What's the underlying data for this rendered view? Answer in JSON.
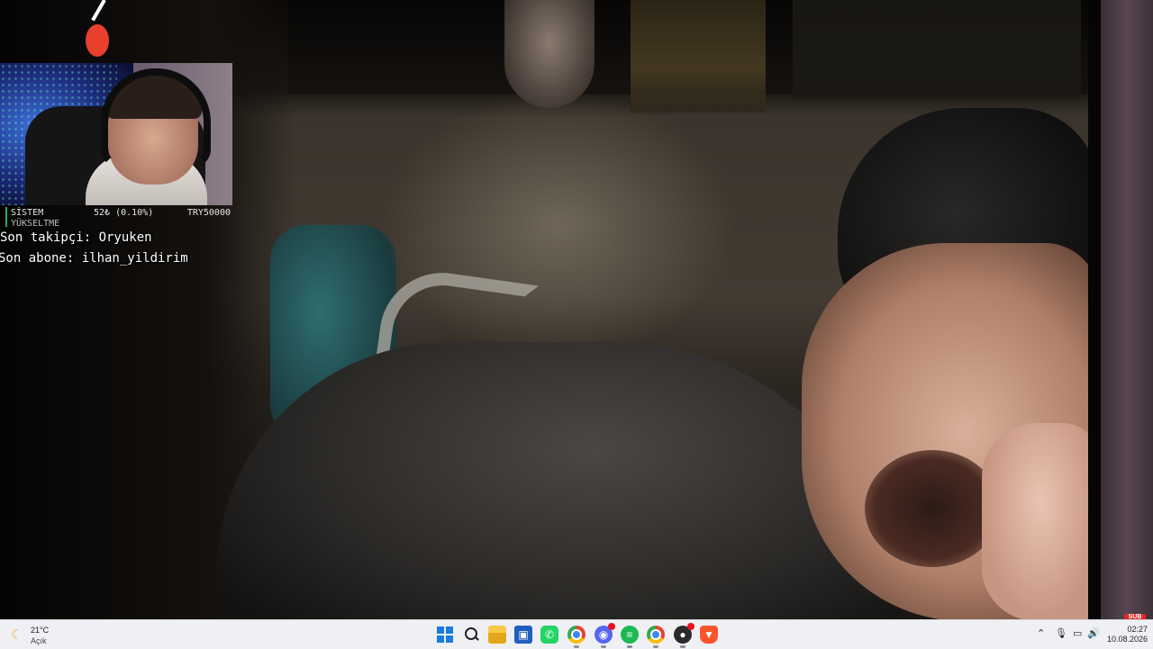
{
  "stream": {
    "stats": {
      "label": "SİSTEM",
      "label2": "YÜKSELTME",
      "value": "52₺ (0.10%)",
      "goal": "TRY50000"
    },
    "last_follower": "Son takipçi: Oryuken",
    "last_subscriber": "Son abone: ilhan_yildirim",
    "sub_badge": "SUB"
  },
  "taskbar": {
    "weather": {
      "temp": "21°C",
      "condition": "Açık",
      "icon": "moon-icon"
    },
    "apps": [
      {
        "name": "start",
        "icon": "windows-start-icon"
      },
      {
        "name": "search",
        "icon": "search-icon"
      },
      {
        "name": "file-explorer",
        "icon": "folder-icon"
      },
      {
        "name": "store",
        "icon": "store-icon"
      },
      {
        "name": "whatsapp",
        "icon": "whatsapp-icon"
      },
      {
        "name": "chrome",
        "icon": "chrome-icon"
      },
      {
        "name": "discord",
        "icon": "discord-icon"
      },
      {
        "name": "spotify",
        "icon": "spotify-icon"
      },
      {
        "name": "chrome-2",
        "icon": "chrome-icon"
      },
      {
        "name": "obs",
        "icon": "obs-icon"
      },
      {
        "name": "brave",
        "icon": "brave-icon"
      }
    ],
    "tray": [
      "chevron-up-icon",
      "microphone-icon",
      "display-icon",
      "volume-icon"
    ],
    "clock": {
      "time": "02:27",
      "date": "10.08.2026"
    }
  },
  "colors": {
    "cursor_marker": "#e8402c",
    "taskbar_bg": "#eef0f4",
    "accent": "#1a7be0"
  }
}
